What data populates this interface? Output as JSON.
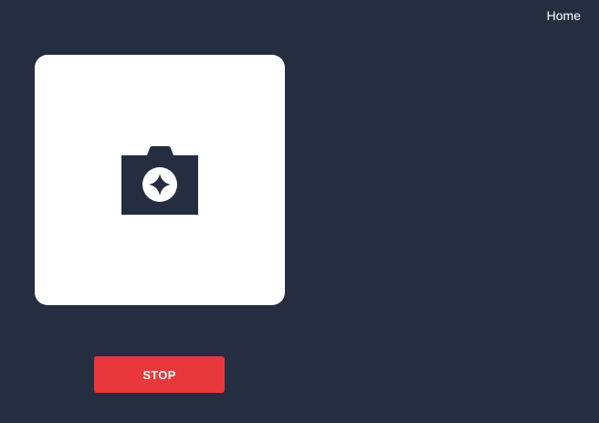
{
  "nav": {
    "home_label": "Home"
  },
  "preview": {
    "icon": "camera-icon"
  },
  "controls": {
    "stop_label": "STOP"
  },
  "colors": {
    "background": "#252e41",
    "card": "#ffffff",
    "icon": "#252e41",
    "stop_button": "#e9383b",
    "text": "#ffffff"
  }
}
